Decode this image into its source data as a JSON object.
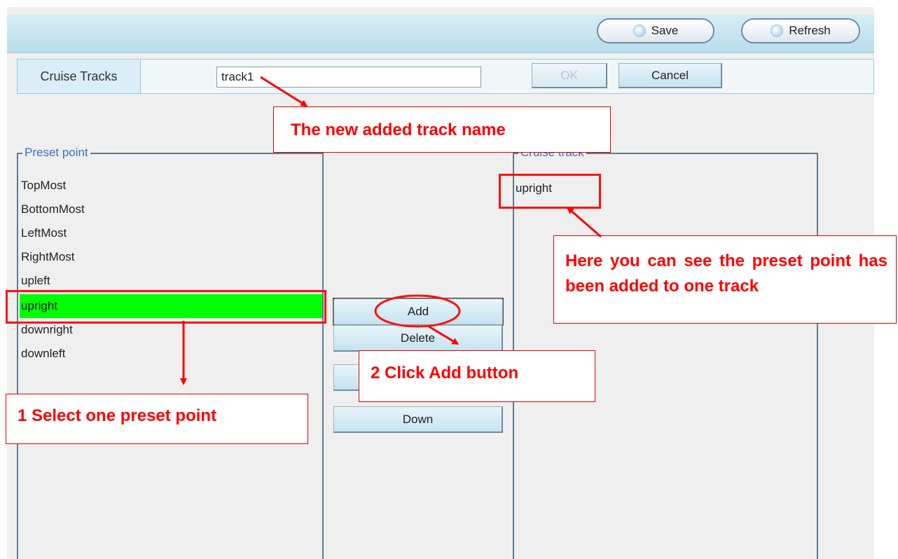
{
  "toolbar": {
    "save_label": "Save",
    "refresh_label": "Refresh"
  },
  "track_row": {
    "label": "Cruise Tracks",
    "track_name_value": "track1",
    "ok_label": "OK",
    "cancel_label": "Cancel"
  },
  "preset_panel": {
    "legend": "Preset point",
    "items": [
      "TopMost",
      "BottomMost",
      "LeftMost",
      "RightMost",
      "upleft",
      "upright",
      "downright",
      "downleft"
    ],
    "selected_item": "upright"
  },
  "middle_buttons": {
    "add_label": "Add",
    "delete_label": "Delete",
    "down_label": "Down"
  },
  "cruise_panel": {
    "legend": "Cruise track",
    "items": [
      "upright"
    ]
  },
  "annotations": {
    "track_name_note": "The new added track name",
    "preset_added_note": "Here you can see the preset point has been added to one track",
    "step1_note": "1 Select one preset point",
    "step2_note": "2 Click Add button",
    "color": "#ff0000"
  },
  "colors": {
    "selected_row": "#00ff00",
    "toolbar": "#b7dcec",
    "legend_text": "#3a6fc4"
  }
}
